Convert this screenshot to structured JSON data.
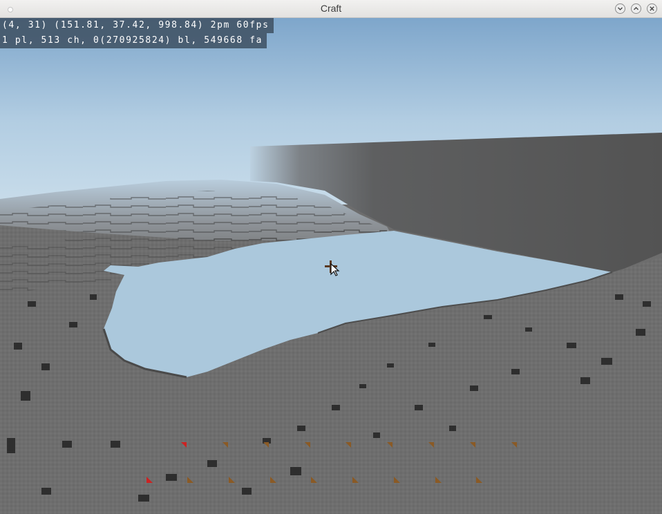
{
  "window": {
    "title": "Craft"
  },
  "hud": {
    "line1": "(4, 31) (151.81, 37.42, 998.84) 2pm 60fps",
    "line2": "1 pl, 513 ch, 0(270925824) bl, 549668 fa"
  },
  "colors": {
    "sky_top": "#7fa7cc",
    "sky_horizon": "#c6dbea",
    "stone": "#6e6e6e",
    "wall": "#555555",
    "water": "#abc8dc",
    "crosshair": "#5a3a22",
    "hud_bg": "#405264",
    "item_brown": "#8a5a25",
    "item_red": "#cc2222"
  },
  "icons": [
    "minimize-icon",
    "maximize-icon",
    "close-icon",
    "crosshair-icon",
    "mouse-pointer-icon"
  ]
}
